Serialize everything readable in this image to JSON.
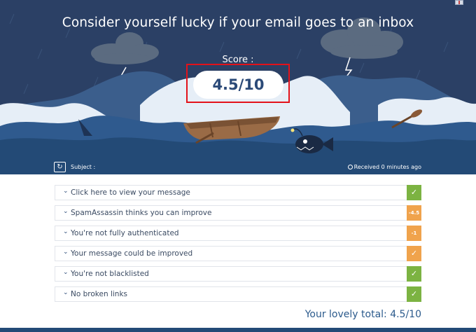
{
  "header": {
    "headline": "Consider yourself lucky if your email goes to an inbox",
    "language_flag": "uk-flag-icon"
  },
  "score": {
    "label": "Score :",
    "value": "4.5/10"
  },
  "subject_bar": {
    "refresh_icon": "refresh-icon",
    "subject_label": "Subject :",
    "received_text": "Received 0 minutes ago",
    "clock_icon": "clock-icon"
  },
  "checks": [
    {
      "label": "Click here to view your message",
      "badge": "✓",
      "status": "pass"
    },
    {
      "label": "SpamAssassin thinks you can improve",
      "badge": "-4.5",
      "status": "warn"
    },
    {
      "label": "You're not fully authenticated",
      "badge": "-1",
      "status": "warn"
    },
    {
      "label": "Your message could be improved",
      "badge": "✓",
      "status": "warn"
    },
    {
      "label": "You're not blacklisted",
      "badge": "✓",
      "status": "pass"
    },
    {
      "label": "No broken links",
      "badge": "✓",
      "status": "pass"
    }
  ],
  "total": "Your lovely total: 4.5/10",
  "colors": {
    "sky": "#2b4065",
    "pass": "#7cb342",
    "warn": "#f0a34c",
    "accent": "#2b4a78",
    "highlight_frame": "#e3121a"
  }
}
